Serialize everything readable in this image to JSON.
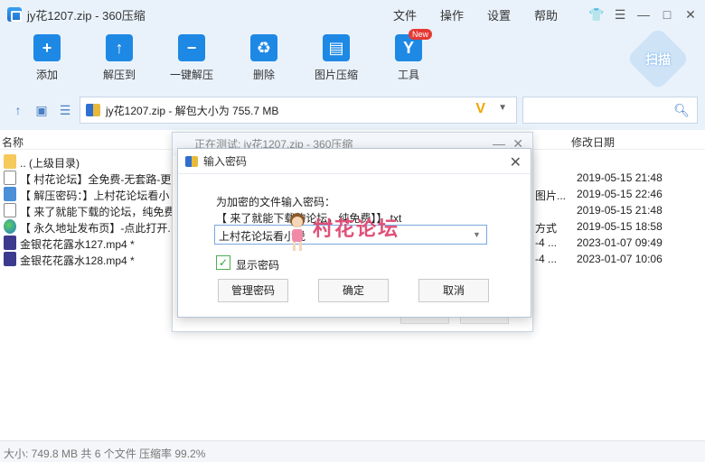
{
  "window": {
    "title": "jy花1207.zip - 360压缩"
  },
  "menu": [
    "文件",
    "操作",
    "设置",
    "帮助"
  ],
  "toolbar": {
    "items": [
      {
        "label": "添加",
        "icon": "add-folder-icon"
      },
      {
        "label": "解压到",
        "icon": "extract-to-icon"
      },
      {
        "label": "一键解压",
        "icon": "one-click-extract-icon"
      },
      {
        "label": "删除",
        "icon": "delete-icon"
      },
      {
        "label": "图片压缩",
        "icon": "image-compress-icon"
      },
      {
        "label": "工具",
        "icon": "tools-icon"
      }
    ],
    "new_badge": "New",
    "scan_label": "扫描"
  },
  "address": {
    "path": "jy花1207.zip - 解包大小为 755.7 MB",
    "v_mark": "V"
  },
  "columns": {
    "name": "名称",
    "modified": "修改日期"
  },
  "files": [
    {
      "name": ".. (上级目录)",
      "extra": "",
      "date": "",
      "icon": "folder-icon"
    },
    {
      "name": "【 村花论坛】全免费-无套路-更",
      "extra": "",
      "date": "2019-05-15 21:48",
      "icon": "text-file-icon"
    },
    {
      "name": "【 解压密码：】上村花论坛看小",
      "extra": "图片...",
      "date": "2019-05-15 22:46",
      "icon": "jpg-file-icon"
    },
    {
      "name": "【 来了就能下载的论坛，纯免费",
      "extra": "",
      "date": "2019-05-15 21:48",
      "icon": "text-file-icon"
    },
    {
      "name": "【 永久地址发布页】-点此打开.",
      "extra": "方式",
      "date": "2019-05-15 18:58",
      "icon": "url-file-icon"
    },
    {
      "name": "金银花花露水127.mp4 *",
      "extra": "-4 ...",
      "date": "2023-01-07 09:49",
      "icon": "mp4-file-icon"
    },
    {
      "name": "金银花花露水128.mp4 *",
      "extra": "-4 ...",
      "date": "2023-01-07 10:06",
      "icon": "mp4-file-icon"
    }
  ],
  "status": "大小: 749.8 MB 共 6 个文件 压缩率 99.2%",
  "test_dialog": {
    "title": "正在测试: jy花1207.zip - 360压缩"
  },
  "password_dialog": {
    "title": "输入密码",
    "prompt": "为加密的文件输入密码：",
    "filename": "【 来了就能下载的论坛，纯免费】】.txt",
    "value": "上村花论坛看小说",
    "show_password_label": "显示密码",
    "show_password_checked": true,
    "manage_label": "管理密码",
    "ok_label": "确定",
    "cancel_label": "取消"
  },
  "watermark": "村花论坛"
}
